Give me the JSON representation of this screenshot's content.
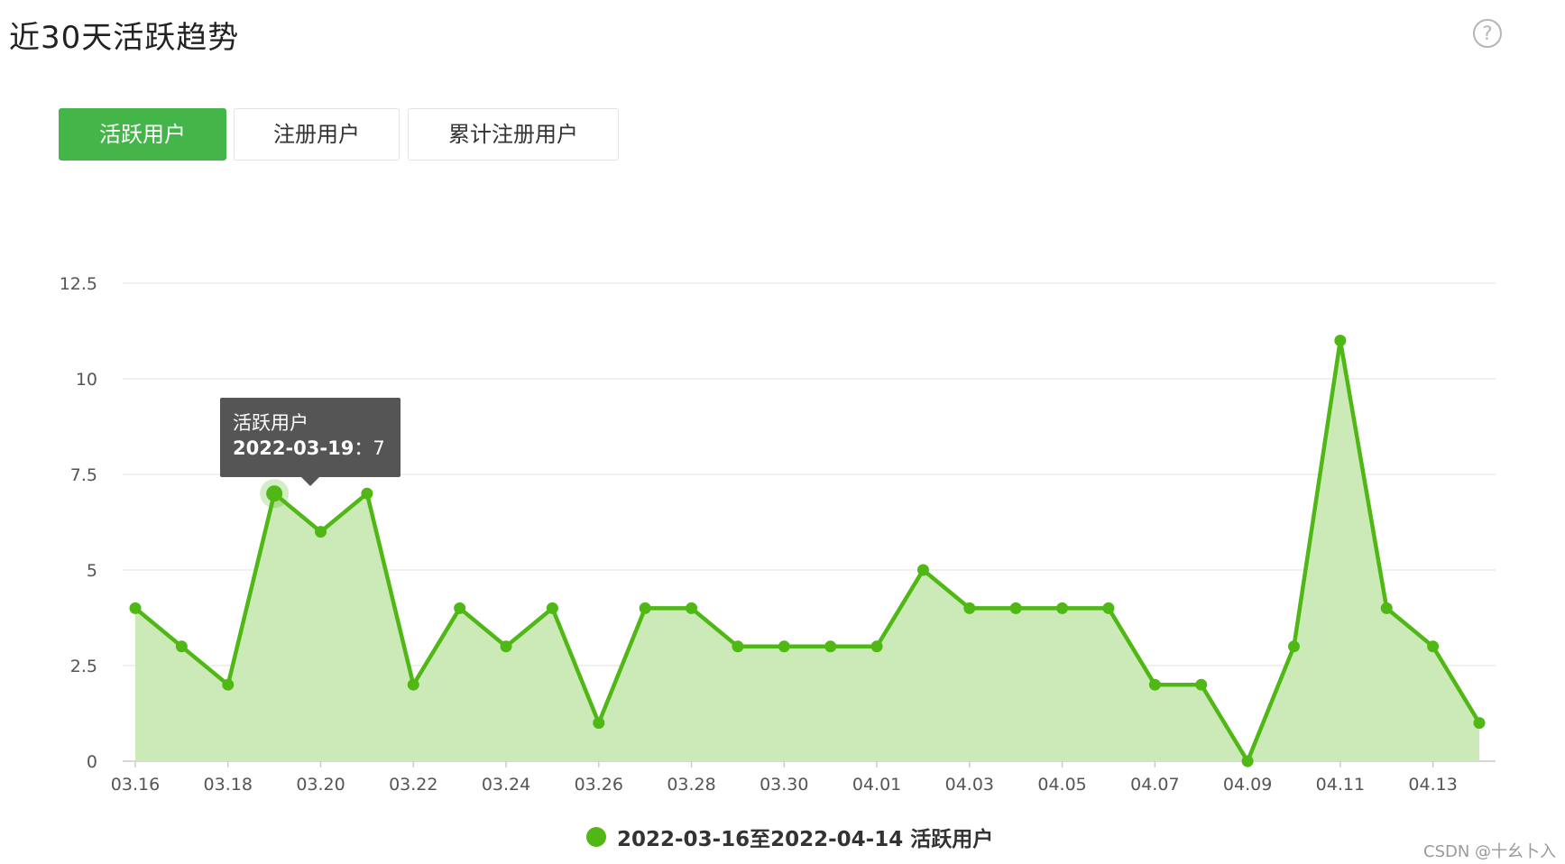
{
  "header": {
    "title": "近30天活跃趋势",
    "help_icon": "question-circle-icon"
  },
  "tabs": [
    {
      "label": "活跃用户",
      "active": true
    },
    {
      "label": "注册用户",
      "active": false
    },
    {
      "label": "累计注册用户",
      "active": false
    }
  ],
  "colors": {
    "accent": "#44b549",
    "line": "#4fb814",
    "area": "#cbeab7",
    "grid": "#e6e6e6"
  },
  "chart_data": {
    "type": "area",
    "x": [
      "03.16",
      "03.17",
      "03.18",
      "03.19",
      "03.20",
      "03.21",
      "03.22",
      "03.23",
      "03.24",
      "03.25",
      "03.26",
      "03.27",
      "03.28",
      "03.29",
      "03.30",
      "03.31",
      "04.01",
      "04.02",
      "04.03",
      "04.04",
      "04.05",
      "04.06",
      "04.07",
      "04.08",
      "04.09",
      "04.10",
      "04.11",
      "04.12",
      "04.13",
      "04.14"
    ],
    "x_tick_labels": [
      "03.16",
      "03.18",
      "03.20",
      "03.22",
      "03.24",
      "03.26",
      "03.28",
      "03.30",
      "04.01",
      "04.03",
      "04.05",
      "04.07",
      "04.09",
      "04.11",
      "04.13"
    ],
    "series": [
      {
        "name": "2022-03-16至2022-04-14 活跃用户",
        "values": [
          4,
          3,
          2,
          7,
          6,
          7,
          2,
          4,
          3,
          4,
          1,
          4,
          4,
          3,
          3,
          3,
          3,
          5,
          4,
          4,
          4,
          4,
          2,
          2,
          0,
          3,
          11,
          4,
          3,
          1
        ]
      }
    ],
    "y_ticks": [
      "0",
      "2.5",
      "5",
      "7.5",
      "10",
      "12.5"
    ],
    "ylim": [
      0,
      12.5
    ],
    "grid": true,
    "legend": "bottom-center",
    "tooltip": {
      "series": "活跃用户",
      "date": "2022-03-19",
      "value": "7"
    }
  },
  "legend": {
    "label": "2022-03-16至2022-04-14 活跃用户"
  },
  "watermark": "CSDN @十幺卜入"
}
